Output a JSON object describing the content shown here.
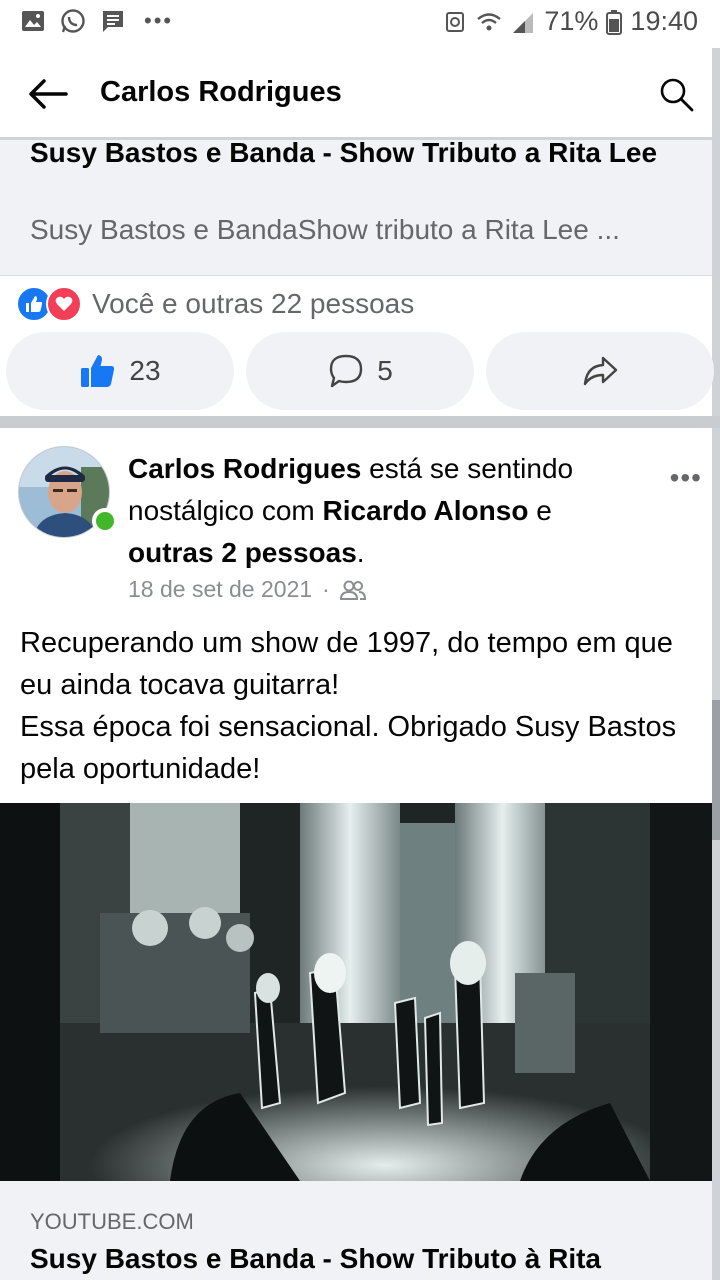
{
  "status_bar": {
    "battery": "71%",
    "time": "19:40",
    "overflow": "•••"
  },
  "header": {
    "title": "Carlos Rodrigues"
  },
  "shared_link_top": {
    "title": "Susy Bastos e Banda - Show Tributo a Rita Lee",
    "description": "Susy Bastos e BandaShow tributo a Rita Lee ..."
  },
  "reactions": {
    "summary": "Você e outras 22 pessoas"
  },
  "actions": {
    "like_count": "23",
    "comment_count": "5"
  },
  "post": {
    "author": "Carlos Rodrigues",
    "feeling_text": " está se sentindo nostálgico com ",
    "tagged": "Ricardo Alonso",
    "and_text": " e ",
    "others": "outras 2 pessoas",
    "end_period": ".",
    "date": "18 de set de 2021",
    "separator_dot": "·",
    "text_line1": "Recuperando um show de 1997, do tempo em que eu ainda tocava guitarra!",
    "text_line2": "Essa época foi sensacional. Obrigado Susy Bastos pela oportunidade!",
    "more_menu": "•••"
  },
  "shared_link_bottom": {
    "domain": "YOUTUBE.COM",
    "title": "Susy Bastos e Banda - Show Tributo à Rita"
  },
  "colors": {
    "accent": "#1877f2",
    "love": "#f33e58",
    "online": "#42b72a",
    "secondary_text": "#65676b"
  }
}
